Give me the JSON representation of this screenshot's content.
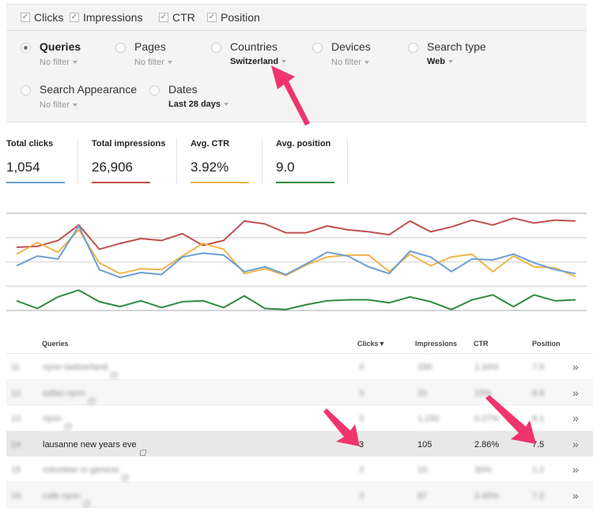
{
  "metrics": [
    {
      "label": "Clicks",
      "checked": true
    },
    {
      "label": "Impressions",
      "checked": true
    },
    {
      "label": "CTR",
      "checked": true
    },
    {
      "label": "Position",
      "checked": true
    }
  ],
  "filters": [
    {
      "label": "Queries",
      "value": "No filter",
      "selected": true,
      "value_set": false
    },
    {
      "label": "Pages",
      "value": "No filter",
      "selected": false,
      "value_set": false
    },
    {
      "label": "Countries",
      "value": "Switzerland",
      "selected": false,
      "value_set": true
    },
    {
      "label": "Devices",
      "value": "No filter",
      "selected": false,
      "value_set": false
    },
    {
      "label": "Search type",
      "value": "Web",
      "selected": false,
      "value_set": true
    },
    {
      "label": "Search Appearance",
      "value": "No filter",
      "selected": false,
      "value_set": false
    },
    {
      "label": "Dates",
      "value": "Last 28 days",
      "selected": false,
      "value_set": true
    }
  ],
  "totals": [
    {
      "label": "Total clicks",
      "value": "1,054",
      "color": "#6a9fd4"
    },
    {
      "label": "Total impressions",
      "value": "26,906",
      "color": "#c0504d"
    },
    {
      "label": "Avg. CTR",
      "value": "3.92%",
      "color": "#f0b54a"
    },
    {
      "label": "Avg. position",
      "value": "9.0",
      "color": "#2e8b3e"
    }
  ],
  "chart_data": {
    "type": "line",
    "title": "",
    "xlabel": "",
    "ylabel": "",
    "grid": true,
    "legend": "none",
    "ylim": [
      0,
      100
    ],
    "note": "No axis labels shown; values are relative positions on a 0-100 scale between bottom and top gridlines",
    "x": [
      1,
      2,
      3,
      4,
      5,
      6,
      7,
      8,
      9,
      10,
      11,
      12,
      13,
      14,
      15,
      16,
      17,
      18,
      19,
      20,
      21,
      22,
      23,
      24,
      25,
      26,
      27,
      28
    ],
    "series": [
      {
        "name": "Impressions",
        "color": "#c0504d",
        "values": [
          65,
          66,
          72,
          88,
          63,
          69,
          74,
          72,
          79,
          67,
          72,
          92,
          89,
          80,
          80,
          87,
          83,
          81,
          78,
          92,
          81,
          86,
          93,
          88,
          95,
          90,
          93,
          92
        ]
      },
      {
        "name": "CTR",
        "color": "#f0b54a",
        "values": [
          58,
          70,
          60,
          83,
          49,
          38,
          43,
          42,
          56,
          69,
          63,
          38,
          43,
          36,
          47,
          55,
          57,
          57,
          40,
          58,
          46,
          55,
          58,
          40,
          56,
          45,
          44,
          35
        ]
      },
      {
        "name": "Clicks",
        "color": "#6a9fd4",
        "values": [
          46,
          56,
          53,
          87,
          42,
          34,
          39,
          37,
          55,
          59,
          57,
          40,
          45,
          37,
          48,
          60,
          56,
          45,
          38,
          61,
          55,
          40,
          53,
          52,
          58,
          49,
          42,
          38
        ]
      },
      {
        "name": "Position",
        "color": "#2e8b3e",
        "values": [
          10,
          2,
          14,
          21,
          9,
          4,
          10,
          3,
          9,
          10,
          3,
          15,
          2,
          1,
          6,
          10,
          11,
          11,
          8,
          14,
          9,
          1,
          11,
          16,
          4,
          16,
          10,
          11
        ]
      }
    ]
  },
  "table": {
    "headers": {
      "queries": "Queries",
      "clicks": "Clicks",
      "impressions": "Impressions",
      "ctr": "CTR",
      "position": "Position"
    },
    "sort_indicator": "▼",
    "rows": [
      {
        "num": "11",
        "query": "nyon switzerland",
        "clicks": "4",
        "impressions": "299",
        "ctr": "1.34%",
        "position": "7.5",
        "blurred": true
      },
      {
        "num": "12",
        "query": "safari nyon",
        "clicks": "3",
        "impressions": "20",
        "ctr": "15%",
        "position": "8.9",
        "blurred": true
      },
      {
        "num": "13",
        "query": "nyon",
        "clicks": "3",
        "impressions": "1,150",
        "ctr": "0.27%",
        "position": "8.1",
        "blurred": true
      },
      {
        "num": "14",
        "query": "lausanne new years eve",
        "clicks": "3",
        "impressions": "105",
        "ctr": "2.86%",
        "position": "7.5",
        "blurred": false
      },
      {
        "num": "15",
        "query": "volunteer in geneva",
        "clicks": "3",
        "impressions": "10",
        "ctr": "30%",
        "position": "1.2",
        "blurred": true
      },
      {
        "num": "16",
        "query": "cafe nyon",
        "clicks": "3",
        "impressions": "87",
        "ctr": "3.45%",
        "position": "7.2",
        "blurred": true
      }
    ],
    "row_action_glyph": "»"
  },
  "annotations": {
    "arrow_color": "#f0346e"
  }
}
